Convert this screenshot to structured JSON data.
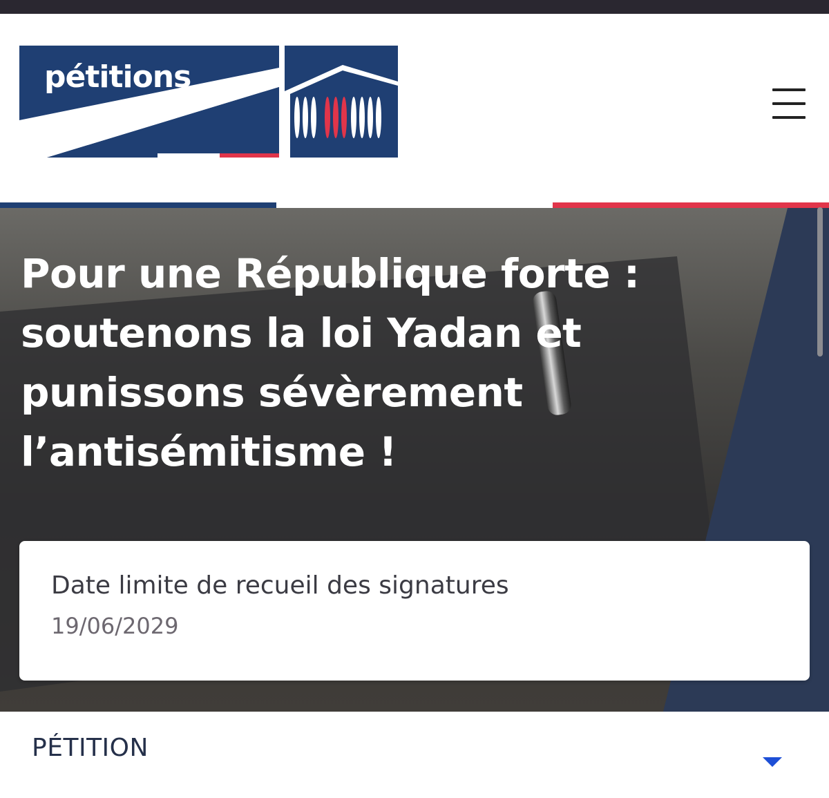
{
  "header": {
    "logo_text": "pétitions",
    "menu_icon": "hamburger-menu-icon"
  },
  "colors": {
    "navy": "#1f3f73",
    "red": "#e1354a",
    "dark_blue_panel": "#2c3a56"
  },
  "hero": {
    "title": "Pour une République forte : soutenons la loi Yadan et punissons sévèrement l’antisémitisme !"
  },
  "deadline": {
    "label": "Date limite de recueil des signatures",
    "date": "19/06/2029"
  },
  "section": {
    "title": "PÉTITION",
    "toggle_icon": "chevron-down-icon"
  }
}
